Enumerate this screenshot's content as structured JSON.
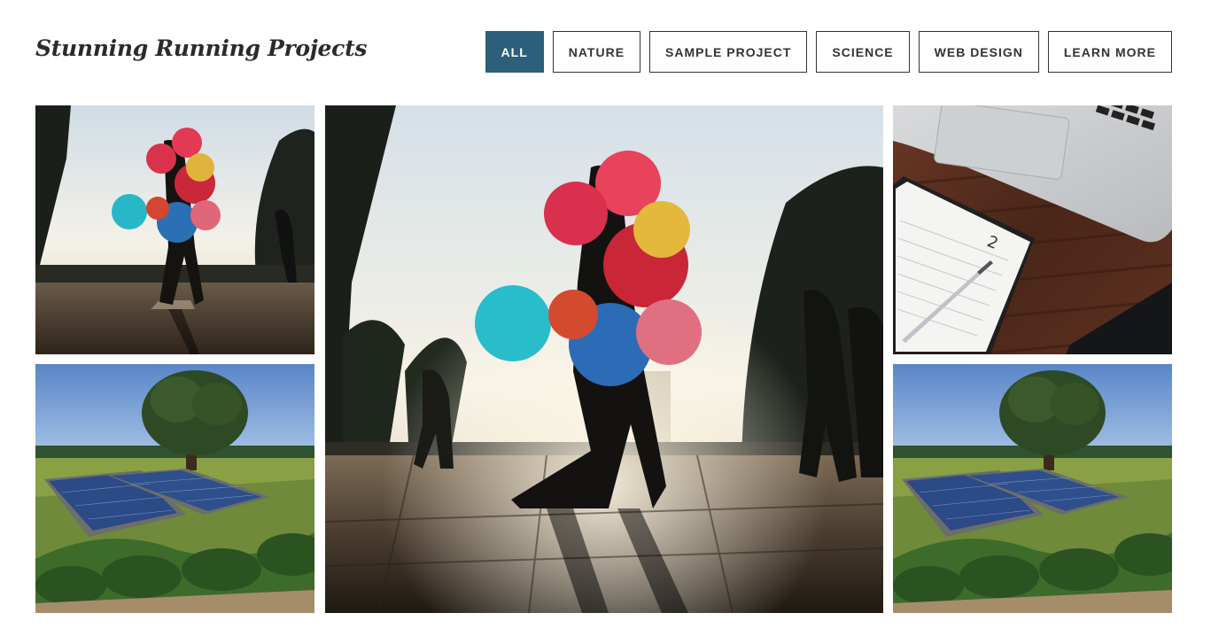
{
  "header": {
    "title": "Stunning Running Projects"
  },
  "filters": [
    {
      "label": "ALL",
      "active": true
    },
    {
      "label": "NATURE",
      "active": false
    },
    {
      "label": "SAMPLE PROJECT",
      "active": false
    },
    {
      "label": "SCIENCE",
      "active": false
    },
    {
      "label": "WEB DESIGN",
      "active": false
    },
    {
      "label": "LEARN MORE",
      "active": false
    }
  ],
  "colors": {
    "active_filter": "#2b5f7a",
    "text": "#333333",
    "background": "#ffffff"
  },
  "gallery": [
    {
      "image": "balloon-seller-photo"
    },
    {
      "image": "balloon-seller-photo-large"
    },
    {
      "image": "laptop-notebook-desk-photo"
    },
    {
      "image": "solar-panels-vineyard-photo"
    },
    {
      "image": "solar-panels-vineyard-photo"
    }
  ]
}
